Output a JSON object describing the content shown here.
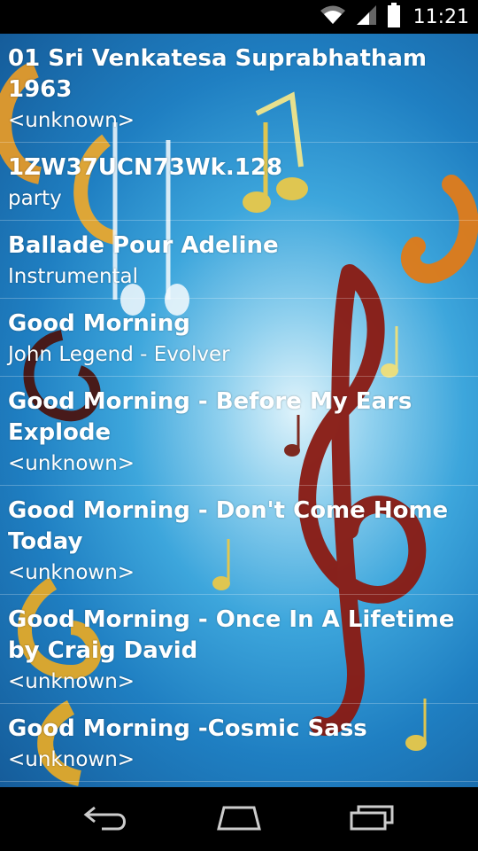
{
  "status_bar": {
    "time": "11:21",
    "icons": [
      "wifi-icon",
      "cell-signal-icon",
      "battery-icon"
    ]
  },
  "songs": [
    {
      "title": "01 Sri Venkatesa Suprabhatham 1963",
      "subtitle": "<unknown>"
    },
    {
      "title": "1ZW37UCN73Wk.128",
      "subtitle": "party"
    },
    {
      "title": "Ballade Pour Adeline",
      "subtitle": "Instrumental"
    },
    {
      "title": "Good Morning",
      "subtitle": "John Legend - Evolver"
    },
    {
      "title": "Good Morning - Before My Ears Explode",
      "subtitle": "<unknown>"
    },
    {
      "title": "Good Morning - Don't Come Home Today",
      "subtitle": "<unknown>"
    },
    {
      "title": "Good Morning - Once In A Lifetime by Craig David",
      "subtitle": "<unknown>"
    },
    {
      "title": "Good Morning -Cosmic Sass",
      "subtitle": "<unknown>"
    }
  ],
  "nav_bar": {
    "buttons": [
      "back-icon",
      "home-icon",
      "recents-icon"
    ]
  },
  "colors": {
    "background_center": "#dff3fb",
    "background_edge": "#155c9a",
    "text": "#ffffff",
    "note_gold": "#e8b93a",
    "note_red": "#8a1a12",
    "bar_bg": "#000000"
  }
}
